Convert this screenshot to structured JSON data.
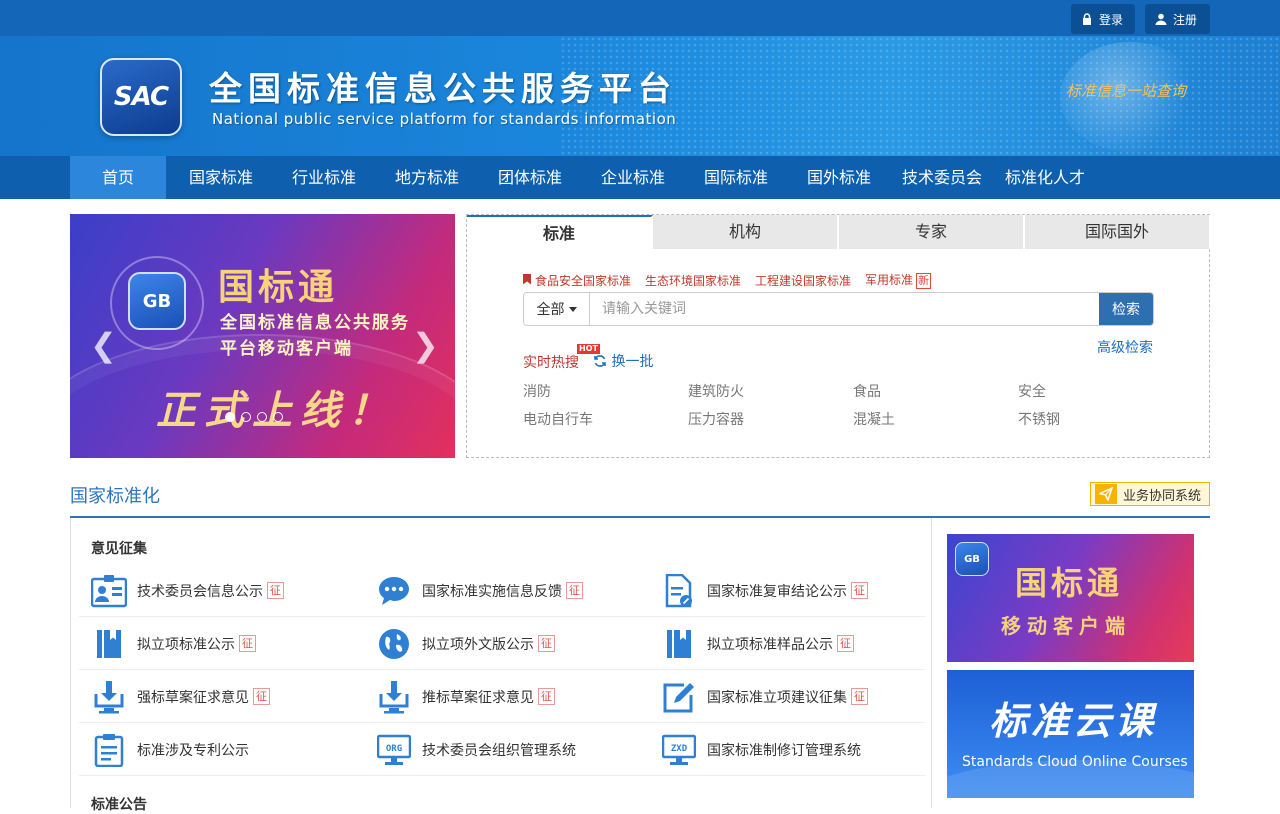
{
  "topbar": {
    "login_label": "登录",
    "register_label": "注册"
  },
  "header": {
    "logo_text": "SAC",
    "title": "全国标准信息公共服务平台",
    "subtitle": "National public service platform  for standards information",
    "slogan": "标准信息一站查询"
  },
  "nav": {
    "items": [
      {
        "label": "首页",
        "active": true
      },
      {
        "label": "国家标准"
      },
      {
        "label": "行业标准"
      },
      {
        "label": "地方标准"
      },
      {
        "label": "团体标准"
      },
      {
        "label": "企业标准"
      },
      {
        "label": "国际标准"
      },
      {
        "label": "国外标准"
      },
      {
        "label": "技术委员会"
      },
      {
        "label": "标准化人才"
      }
    ]
  },
  "carousel": {
    "icon_text": "GB",
    "title": "国标通",
    "line1": "全国标准信息公共服务",
    "line2": "平台移动客户端",
    "big": "正式上线！",
    "prev": "❮",
    "next": "❯",
    "slide_count": 4,
    "active_index": 0
  },
  "search": {
    "tabs": [
      "标准",
      "机构",
      "专家",
      "国际国外"
    ],
    "active_tab": 0,
    "hot_links": [
      "食品安全国家标准",
      "生态环境国家标准",
      "工程建设国家标准",
      "军用标准"
    ],
    "new_tag": "新",
    "scope": "全部",
    "placeholder": "请输入关键词",
    "button": "检索",
    "advanced": "高级检索",
    "hot_label": "实时热搜",
    "hot_badge": "HOT",
    "swap": "换一批",
    "keywords": [
      "消防",
      "建筑防火",
      "食品",
      "安全",
      "电动自行车",
      "压力容器",
      "混凝土",
      "不锈钢"
    ]
  },
  "section": {
    "title": "国家标准化",
    "biz_button": "业务协同系统",
    "panel_title": "意见征集",
    "panel_title2": "标准公告",
    "tag": "征",
    "rows": [
      [
        {
          "label": "技术委员会信息公示",
          "tag": true,
          "icon": "id-card-icon"
        },
        {
          "label": "国家标准实施信息反馈",
          "tag": true,
          "icon": "chat-bubble-icon"
        },
        {
          "label": "国家标准复审结论公示",
          "tag": true,
          "icon": "document-edit-icon"
        }
      ],
      [
        {
          "label": "拟立项标准公示",
          "tag": true,
          "icon": "book-icon"
        },
        {
          "label": "拟立项外文版公示",
          "tag": true,
          "icon": "globe-icon"
        },
        {
          "label": "拟立项标准样品公示",
          "tag": true,
          "icon": "book-icon"
        }
      ],
      [
        {
          "label": "强标草案征求意见",
          "tag": true,
          "icon": "download-icon"
        },
        {
          "label": "推标草案征求意见",
          "tag": true,
          "icon": "download-icon"
        },
        {
          "label": "国家标准立项建议征集",
          "tag": true,
          "icon": "pencil-square-icon"
        }
      ],
      [
        {
          "label": "标准涉及专利公示",
          "tag": false,
          "icon": "clipboard-icon"
        },
        {
          "label": "技术委员会组织管理系统",
          "tag": false,
          "icon": "org-monitor-icon",
          "icon_text": "ORG"
        },
        {
          "label": "国家标准制修订管理系统",
          "tag": false,
          "icon": "zxd-monitor-icon",
          "icon_text": "ZXD"
        }
      ]
    ]
  },
  "ads": {
    "ad1_icon": "GB",
    "ad1_title": "国标通",
    "ad1_sub": "移动客户端",
    "ad2_title": "标准云课",
    "ad2_sub": "Standards Cloud Online Courses"
  },
  "colors": {
    "brand_blue": "#1467b8",
    "nav_blue": "#0e5fad",
    "nav_active": "#2b86dc",
    "accent_red": "#c0392b",
    "link_blue": "#1e6fbe"
  }
}
